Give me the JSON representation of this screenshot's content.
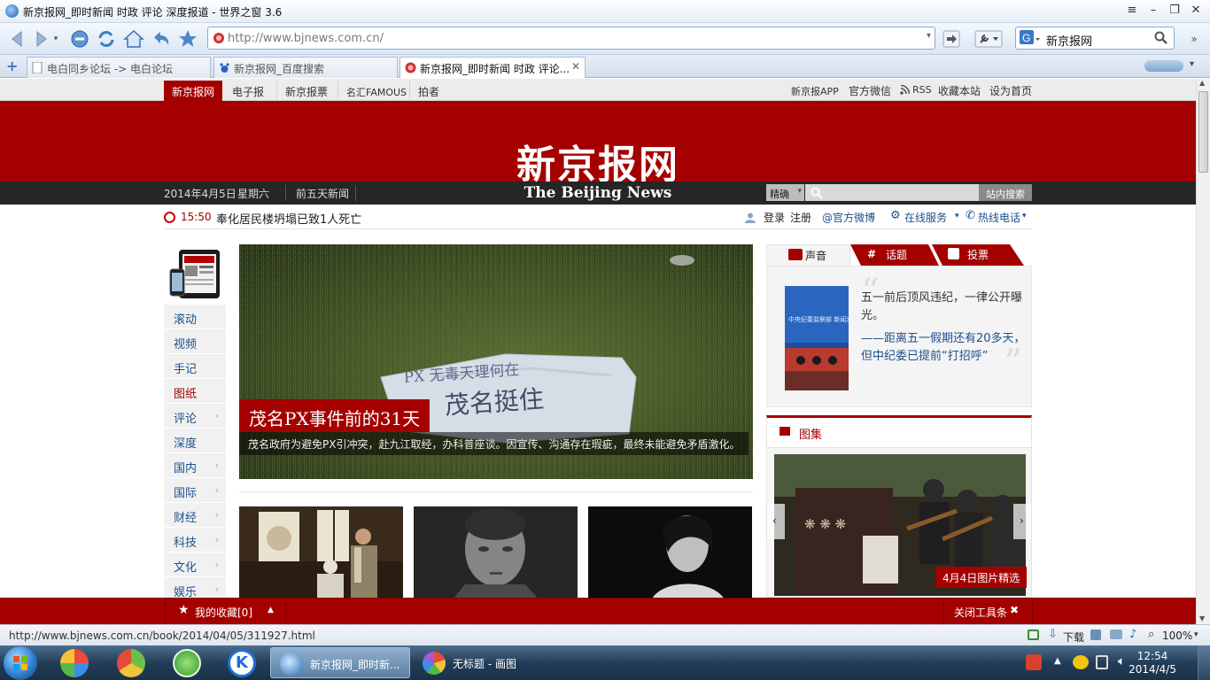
{
  "browser": {
    "window_title": "新京报网_即时新闻 时政 评论 深度报道 - 世界之窗 3.6",
    "url": "http://www.bjnews.com.cn/",
    "search_value": "新京报网",
    "tabs": [
      {
        "label": "电白同乡论坛 -> 电白论坛",
        "active": false
      },
      {
        "label": "新京报网_百度搜索",
        "active": false
      },
      {
        "label": "新京报网_即时新闻 时政 评论...",
        "active": true
      }
    ],
    "status_url": "http://www.bjnews.com.cn/book/2014/04/05/311927.html",
    "status_download": "下载",
    "zoom": "100%"
  },
  "site": {
    "top_nav": [
      "新京报网",
      "电子报",
      "新京报票",
      "名汇FAMOUS",
      "拍者"
    ],
    "top_right": [
      "新京报APP",
      "官方微信",
      "RSS",
      "收藏本站",
      "设为首页"
    ],
    "logo_cn": "新京报网",
    "logo_en": "The Beijing News",
    "date": "2014年4月5日",
    "weekday": "星期六",
    "prev_news": "前五天新闻",
    "search_mode": "精确",
    "search_button": "站内搜索",
    "ticker_time": "15:50",
    "ticker_text": "奉化居民楼坍塌已致1人死亡",
    "user_links": [
      "登录",
      "注册",
      "@官方微博",
      "在线服务",
      "热线电话"
    ],
    "side_nav": [
      {
        "label": "滚动",
        "red": false,
        "arrow": false
      },
      {
        "label": "视频",
        "red": false,
        "arrow": false
      },
      {
        "label": "手记",
        "red": false,
        "arrow": false
      },
      {
        "label": "图纸",
        "red": true,
        "arrow": false
      },
      {
        "label": "评论",
        "red": false,
        "arrow": true
      },
      {
        "label": "深度",
        "red": false,
        "arrow": false
      },
      {
        "label": "国内",
        "red": false,
        "arrow": true
      },
      {
        "label": "国际",
        "red": false,
        "arrow": true
      },
      {
        "label": "财经",
        "red": false,
        "arrow": true
      },
      {
        "label": "科技",
        "red": false,
        "arrow": true
      },
      {
        "label": "文化",
        "red": false,
        "arrow": true
      },
      {
        "label": "娱乐",
        "red": false,
        "arrow": true
      }
    ],
    "hero": {
      "title": "茂名PX事件前的31天",
      "subtitle": "茂名政府为避免PX引冲突，赴九江取经，办科普座谈。因宣传、沟通存在瑕疵，最终未能避免矛盾激化。",
      "banner_text": "茂名挺住",
      "banner_text_top": "PX 无毒天理何在"
    },
    "right_tabs": [
      "声音",
      "话题",
      "投票"
    ],
    "voice": {
      "line1": "五一前后顶风违纪，一律公开曝光。",
      "line2": "——距离五一假期还有20多天，但中纪委已提前“打招呼”",
      "image_caption": "中央纪委监察部 新闻发布会"
    },
    "gallery_title": "图集",
    "gallery_caption": "4月4日图片精选",
    "fav_bar": {
      "favorites": "我的收藏[0]",
      "close": "关闭工具条"
    }
  },
  "taskbar": {
    "tasks": [
      {
        "label": "新京报网_即时新...",
        "active": true
      },
      {
        "label": "无标题 - 画图",
        "active": false
      }
    ],
    "time": "12:54",
    "date": "2014/4/5"
  },
  "colors": {
    "brand_red": "#a50000",
    "dark_bar": "#262626",
    "link_blue": "#1d4f8c"
  }
}
